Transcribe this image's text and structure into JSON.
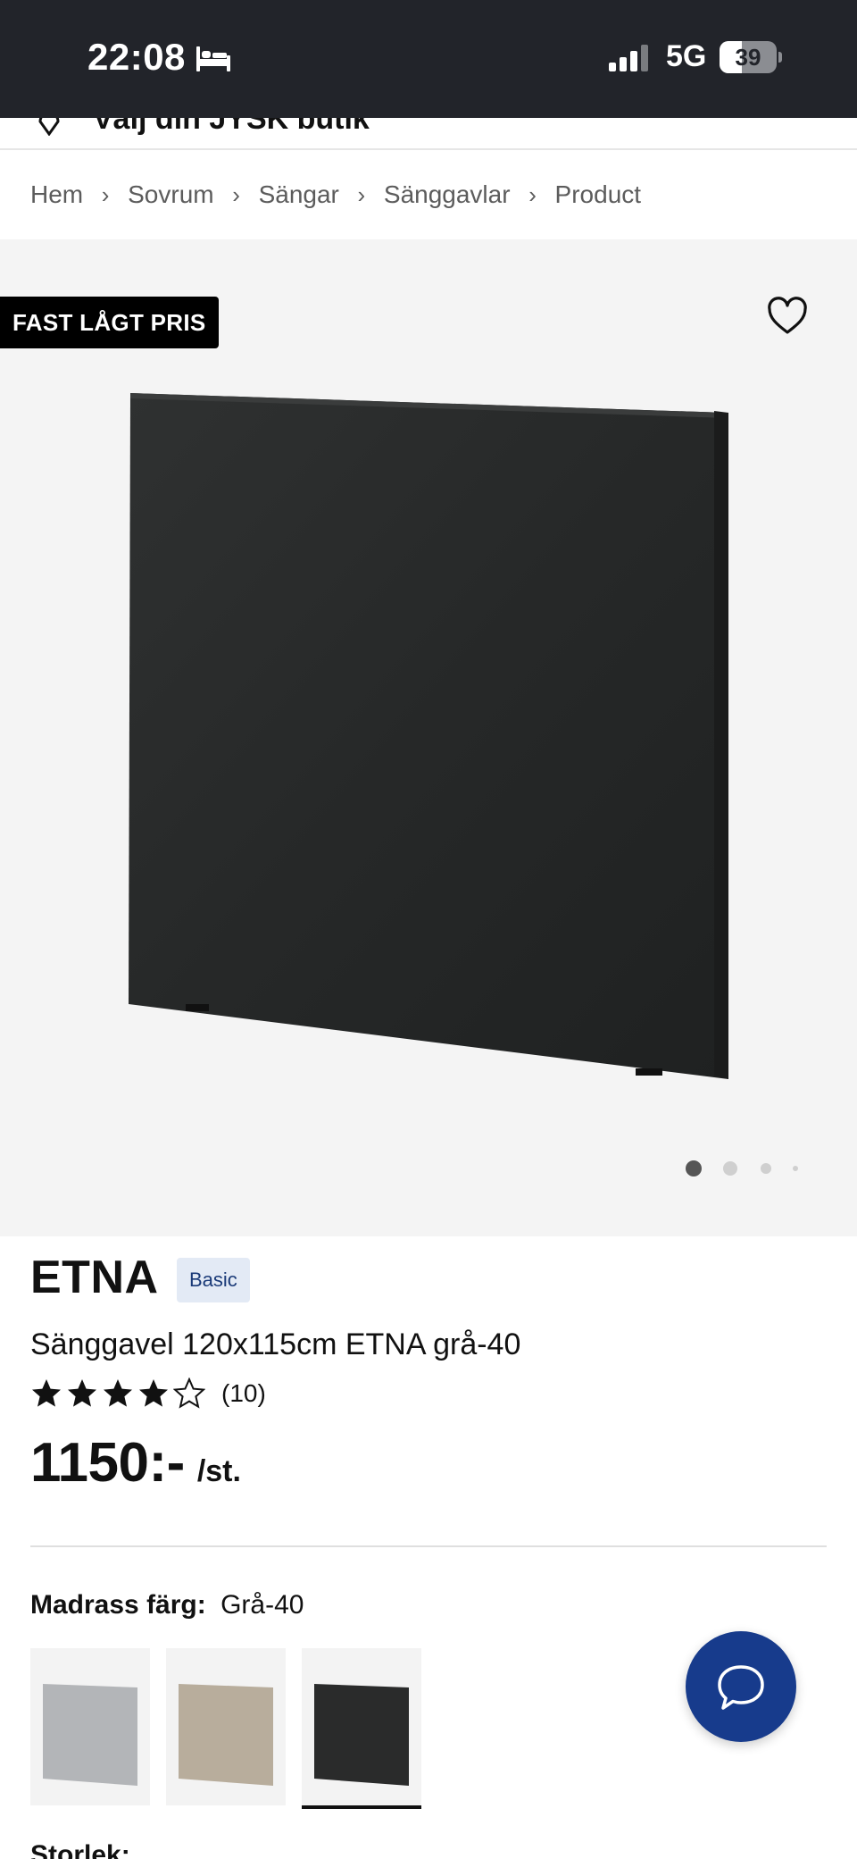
{
  "status_bar": {
    "time": "22:08",
    "network": "5G",
    "battery": "39",
    "battery_level": 0.39
  },
  "store_selector": {
    "label": "Välj din JYSK butik"
  },
  "breadcrumb": [
    "Hem",
    "Sovrum",
    "Sängar",
    "Sänggavlar",
    "Product"
  ],
  "gallery": {
    "badge": "FAST LÅGT PRIS",
    "image_count": 4,
    "active_index": 0
  },
  "product": {
    "brand": "ETNA",
    "tier_badge": "Basic",
    "title": "Sänggavel 120x115cm ETNA grå-40",
    "rating": 4,
    "rating_max": 5,
    "review_count": "(10)",
    "price": "1150:-",
    "price_unit": "/st."
  },
  "color_option": {
    "label": "Madrass färg:",
    "value": "Grå-40",
    "swatches": [
      {
        "name": "light-grey",
        "color": "#b3b5b8",
        "selected": false
      },
      {
        "name": "beige",
        "color": "#b8ad9c",
        "selected": false
      },
      {
        "name": "dark-grey",
        "color": "#2a2b2b",
        "selected": true
      }
    ]
  },
  "size_option": {
    "label": "Storlek:"
  },
  "colors": {
    "status_bar_bg": "#22242a",
    "gallery_bg": "#f4f4f4",
    "chat_button": "#173b8c",
    "badge_bg": "#000000",
    "tier_badge_bg": "#e3eaf5",
    "tier_badge_text": "#1a3a78"
  },
  "icons": {
    "status_bar": [
      "bed-icon",
      "signal-icon",
      "battery-icon"
    ],
    "store": "location-pin-icon",
    "gallery": "heart-icon",
    "chat": "chat-bubble-icon",
    "rating": "star-icon"
  }
}
